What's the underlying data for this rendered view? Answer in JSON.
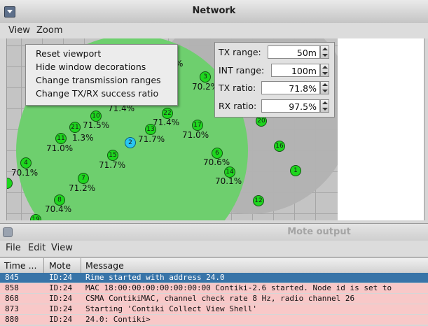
{
  "network_window": {
    "title": "Network",
    "menu": [
      "View",
      "Zoom"
    ]
  },
  "context_menu": {
    "items": [
      "Reset viewport",
      "Hide window decorations",
      "Change transmission ranges",
      "Change TX/RX success ratio"
    ]
  },
  "controls": {
    "tx_range": {
      "label": "TX range:",
      "value": "50m"
    },
    "int_range": {
      "label": "INT range:",
      "value": "100m"
    },
    "tx_ratio": {
      "label": "TX ratio:",
      "value": "71.8%"
    },
    "rx_ratio": {
      "label": "RX ratio:",
      "value": "97.5%"
    }
  },
  "nodes": [
    {
      "id": "1"
    },
    {
      "id": "2"
    },
    {
      "id": "3"
    },
    {
      "id": "4"
    },
    {
      "id": "6"
    },
    {
      "id": "7"
    },
    {
      "id": "8"
    },
    {
      "id": "10"
    },
    {
      "id": "11"
    },
    {
      "id": "12"
    },
    {
      "id": "13"
    },
    {
      "id": "14"
    },
    {
      "id": "15"
    },
    {
      "id": "16"
    },
    {
      "id": "17"
    },
    {
      "id": "19"
    },
    {
      "id": "20"
    },
    {
      "id": "21"
    },
    {
      "id": "22"
    }
  ],
  "node_labels": {
    "n3": "70.2%",
    "n10_top": "71.4%",
    "n10": "71.5%",
    "n22": "71.4%",
    "n21": "1.3%",
    "n11": "71.0%",
    "n13": "71.7%",
    "n17": "71.0%",
    "n15": "71.7%",
    "n6": "70.6%",
    "n14": "70.1%",
    "n4": "70.1%",
    "n7": "71.2%",
    "n8": "70.4%",
    "frag_top": "%"
  },
  "mote_window": {
    "title": "Mote output",
    "menu": [
      "File",
      "Edit",
      "View"
    ],
    "columns": [
      "Time ...",
      "Mote",
      "Message"
    ],
    "rows": [
      {
        "time": "845",
        "mote": "ID:24",
        "message": "Rime started with address 24.0",
        "selected": true
      },
      {
        "time": "858",
        "mote": "ID:24",
        "message": "MAC 18:00:00:00:00:00:00:00 Contiki-2.6 started. Node id is set to"
      },
      {
        "time": "868",
        "mote": "ID:24",
        "message": "CSMA ContikiMAC, channel check rate 8 Hz, radio channel 26"
      },
      {
        "time": "873",
        "mote": "ID:24",
        "message": "Starting 'Contiki Collect View Shell'"
      },
      {
        "time": "880",
        "mote": "ID:24",
        "message": "24.0: Contiki>"
      }
    ]
  },
  "colors": {
    "node": "#1ed61e",
    "selected_node": "#29c6f2",
    "tx_range_area": "#6ecf6e",
    "int_range_area": "#b2b2b2",
    "log_row": "#f8c8c8",
    "log_row_selected": "#3874a8"
  }
}
